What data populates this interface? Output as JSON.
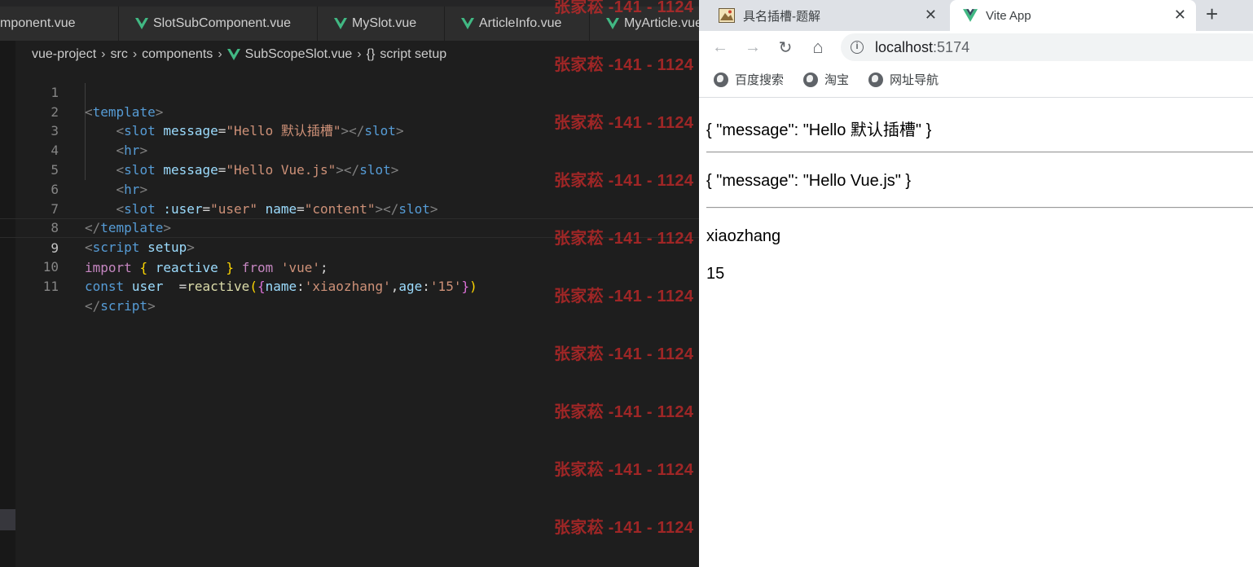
{
  "editor": {
    "tabs": [
      {
        "label": "mponent.vue",
        "icon": "vue-icon"
      },
      {
        "label": "SlotSubComponent.vue",
        "icon": "vue-icon"
      },
      {
        "label": "MySlot.vue",
        "icon": "vue-icon"
      },
      {
        "label": "ArticleInfo.vue",
        "icon": "vue-icon"
      },
      {
        "label": "MyArticle.vue",
        "icon": "vue-icon"
      }
    ],
    "breadcrumb": {
      "project": "vue-project",
      "folder1": "src",
      "folder2": "components",
      "file": "SubScopeSlot.vue",
      "symbol_icon": "{}",
      "symbol": "script setup",
      "separator": "›"
    },
    "current_line": 9,
    "lines": [
      {
        "n": "1"
      },
      {
        "n": "2"
      },
      {
        "n": "3"
      },
      {
        "n": "4"
      },
      {
        "n": "5"
      },
      {
        "n": "6"
      },
      {
        "n": "7"
      },
      {
        "n": "8"
      },
      {
        "n": "9"
      },
      {
        "n": "10"
      },
      {
        "n": "11"
      }
    ],
    "code": {
      "l1": {
        "lt": "<",
        "tag": "template",
        "gt": ">"
      },
      "l2": {
        "indent": "    ",
        "lt": "<",
        "tag": "slot",
        "sp": " ",
        "attr": "message",
        "eq": "=",
        "val": "\"Hello 默认插槽\"",
        "gt": ">",
        "close_lt": "</",
        "close_tag": "slot",
        "close_gt": ">"
      },
      "l3": {
        "indent": "    ",
        "lt": "<",
        "tag": "hr",
        "gt": ">"
      },
      "l4": {
        "indent": "    ",
        "lt": "<",
        "tag": "slot",
        "sp": " ",
        "attr": "message",
        "eq": "=",
        "val": "\"Hello Vue.js\"",
        "gt": ">",
        "close_lt": "</",
        "close_tag": "slot",
        "close_gt": ">"
      },
      "l5": {
        "indent": "    ",
        "lt": "<",
        "tag": "hr",
        "gt": ">"
      },
      "l6": {
        "indent": "    ",
        "lt": "<",
        "tag": "slot",
        "sp": " ",
        "attr1": ":user",
        "eq1": "=",
        "val1": "\"user\"",
        "sp2": " ",
        "attr2": "name",
        "eq2": "=",
        "val2": "\"content\"",
        "gt": ">",
        "close_lt": "</",
        "close_tag": "slot",
        "close_gt": ">"
      },
      "l7": {
        "lt": "</",
        "tag": "template",
        "gt": ">"
      },
      "l8": {
        "lt": "<",
        "tag": "script",
        "sp": " ",
        "attr": "setup",
        "gt": ">"
      },
      "l9": {
        "kw": "import",
        "sp1": " ",
        "lb": "{",
        "mid": " ",
        "name": "reactive",
        "mid2": " ",
        "rb": "}",
        "sp2": " ",
        "from": "from",
        "sp3": " ",
        "mod": "'vue'",
        "semi": ";"
      },
      "l10": {
        "kw": "const",
        "sp1": " ",
        "var": "user",
        "sp2": "  ",
        "eq": "=",
        "fn": "reactive",
        "lp": "(",
        "lb": "{",
        "k1": "name",
        "c1": ":",
        "v1": "'xiaozhang'",
        "comma": ",",
        "k2": "age",
        "c2": ":",
        "v2": "'15'",
        "rb": "}",
        "rp": ")"
      },
      "l11": {
        "lt": "</",
        "tag": "script",
        "gt": ">"
      }
    }
  },
  "watermark": {
    "text": "张家菘 -141 - 1124",
    "count": 10
  },
  "browser": {
    "tabs": [
      {
        "title": "具名插槽-题解",
        "icon": "favicon-image-icon",
        "close": "✕",
        "active": false
      },
      {
        "title": "Vite App",
        "icon": "vue-icon",
        "close": "✕",
        "active": true
      }
    ],
    "new_tab": "+",
    "nav": {
      "back": "←",
      "forward": "→",
      "reload": "↻",
      "home": "⌂"
    },
    "address": {
      "host": "localhost",
      "port": ":5174",
      "info_icon": "i"
    },
    "bookmarks": [
      {
        "label": "百度搜索",
        "icon": "globe-icon"
      },
      {
        "label": "淘宝",
        "icon": "globe-icon"
      },
      {
        "label": "网址导航",
        "icon": "globe-icon"
      }
    ],
    "page": {
      "slot1": "{ \"message\": \"Hello 默认插槽\" }",
      "slot2": "{ \"message\": \"Hello Vue.js\" }",
      "name": "xiaozhang",
      "age": "15"
    }
  },
  "colors": {
    "editor_bg": "#1e1e1e",
    "vue_green": "#41b883",
    "watermark_red": "#d12a2a",
    "tag_blue": "#569cd6",
    "string_orange": "#ce9178",
    "attr_lightblue": "#9cdcfe",
    "keyword_purple": "#c586c0"
  }
}
